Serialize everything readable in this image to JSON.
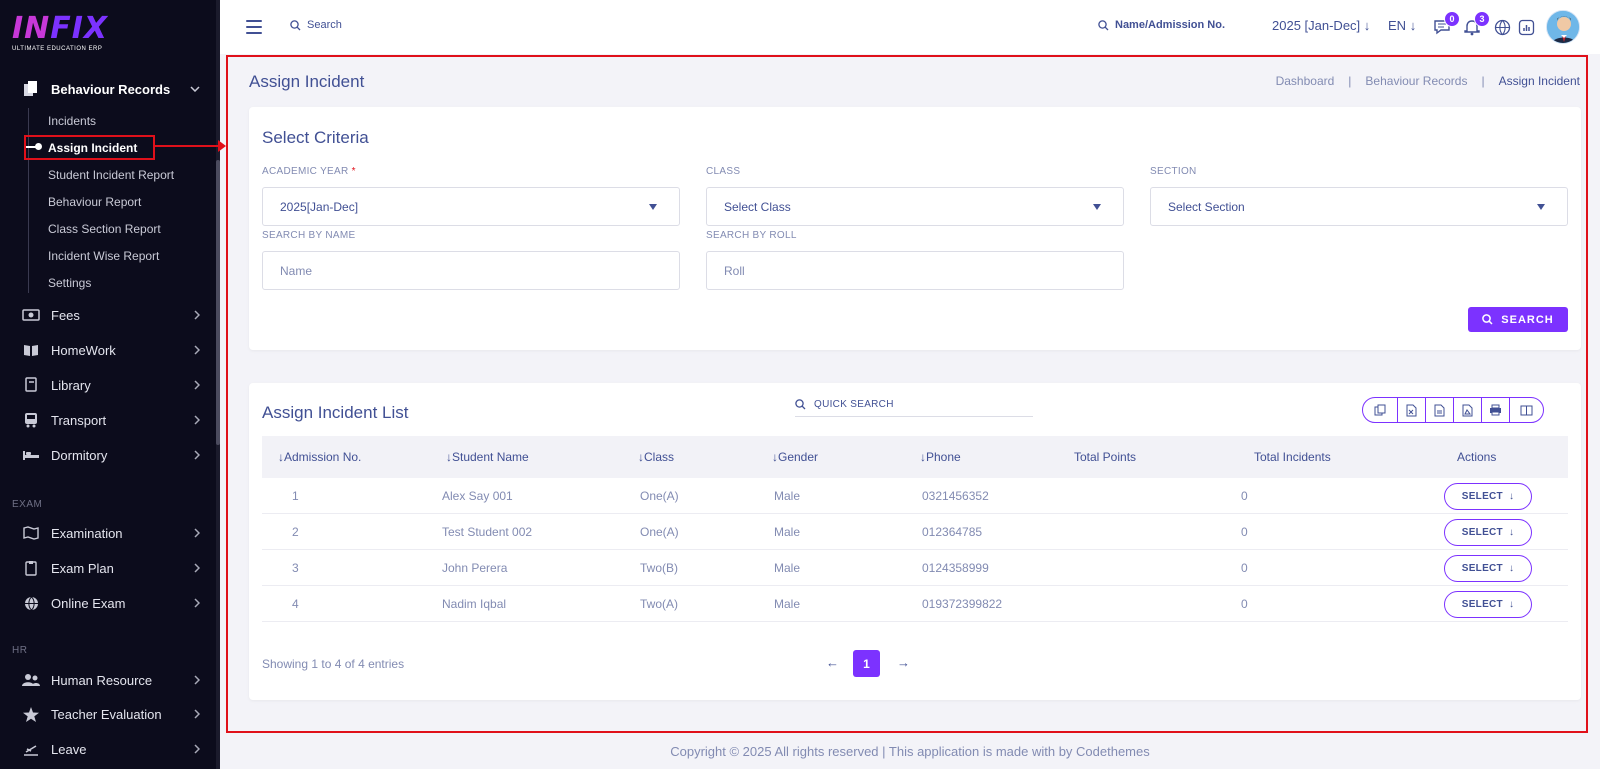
{
  "logo": {
    "brand_a": "IN",
    "brand_b": "FIX",
    "subtitle": "ULTIMATE EDUCATION ERP"
  },
  "sidebar": {
    "open_section": {
      "label": "Behaviour Records",
      "icon": "document-icon"
    },
    "sub_items": [
      "Incidents",
      "Assign Incident",
      "Student Incident Report",
      "Behaviour Report",
      "Class Section Report",
      "Incident Wise Report",
      "Settings"
    ],
    "items_a": [
      {
        "label": "Fees",
        "icon": "money-icon"
      },
      {
        "label": "HomeWork",
        "icon": "book-icon"
      },
      {
        "label": "Library",
        "icon": "library-icon"
      },
      {
        "label": "Transport",
        "icon": "bus-icon"
      },
      {
        "label": "Dormitory",
        "icon": "bed-icon"
      }
    ],
    "group_exam": "EXAM",
    "items_exam": [
      {
        "label": "Examination",
        "icon": "map-icon"
      },
      {
        "label": "Exam Plan",
        "icon": "clipboard-icon"
      },
      {
        "label": "Online Exam",
        "icon": "globe-icon"
      }
    ],
    "group_hr": "HR",
    "items_hr": [
      {
        "label": "Human Resource",
        "icon": "users-icon"
      },
      {
        "label": "Teacher Evaluation",
        "icon": "star-icon"
      },
      {
        "label": "Leave",
        "icon": "leave-icon"
      }
    ]
  },
  "topbar": {
    "search_label": "Search",
    "search_student_label": "Name/Admission No.",
    "year": "2025 [Jan-Dec]",
    "lang": "EN",
    "messages_count": "0",
    "notifications_count": "3"
  },
  "page": {
    "title": "Assign Incident",
    "breadcrumb": [
      "Dashboard",
      "|",
      "Behaviour Records",
      "|",
      "Assign Incident"
    ]
  },
  "criteria": {
    "title": "Select Criteria",
    "academic_year_label": "ACADEMIC YEAR",
    "academic_year_required": "*",
    "academic_year_value": "2025[Jan-Dec]",
    "class_label": "CLASS",
    "class_placeholder": "Select Class",
    "section_label": "SECTION",
    "section_placeholder": "Select Section",
    "name_label": "SEARCH BY NAME",
    "name_placeholder": "Name",
    "roll_label": "SEARCH BY ROLL",
    "roll_placeholder": "Roll",
    "search_button": "SEARCH"
  },
  "list": {
    "title": "Assign Incident List",
    "quick_search": "QUICK SEARCH",
    "export_icons": [
      "copy-icon",
      "excel-icon",
      "csv-icon",
      "pdf-icon",
      "print-icon",
      "columns-icon"
    ],
    "columns": [
      "Admission No.",
      "Student Name",
      "Class",
      "Gender",
      "Phone",
      "Total Points",
      "Total Incidents",
      "Actions"
    ],
    "rows": [
      {
        "adm": "1",
        "name": "Alex Say 001",
        "class": "One(A)",
        "gender": "Male",
        "phone": "0321456352",
        "points": "",
        "incidents": "0",
        "action": "SELECT"
      },
      {
        "adm": "2",
        "name": "Test Student 002",
        "class": "One(A)",
        "gender": "Male",
        "phone": "012364785",
        "points": "",
        "incidents": "0",
        "action": "SELECT"
      },
      {
        "adm": "3",
        "name": "John Perera",
        "class": "Two(B)",
        "gender": "Male",
        "phone": "0124358999",
        "points": "",
        "incidents": "0",
        "action": "SELECT"
      },
      {
        "adm": "4",
        "name": "Nadim Iqbal",
        "class": "Two(A)",
        "gender": "Male",
        "phone": "019372399822",
        "points": "",
        "incidents": "0",
        "action": "SELECT"
      }
    ],
    "entries_text": "Showing 1 to 4 of 4 entries",
    "page_current": "1"
  },
  "footer": "Copyright © 2025 All rights reserved | This application is made with by Codethemes",
  "colors": {
    "accent": "#7c32ff",
    "text": "#415094",
    "muted": "#828bb2",
    "highlight": "#e0101a",
    "sidebar": "#0c0c1c"
  }
}
